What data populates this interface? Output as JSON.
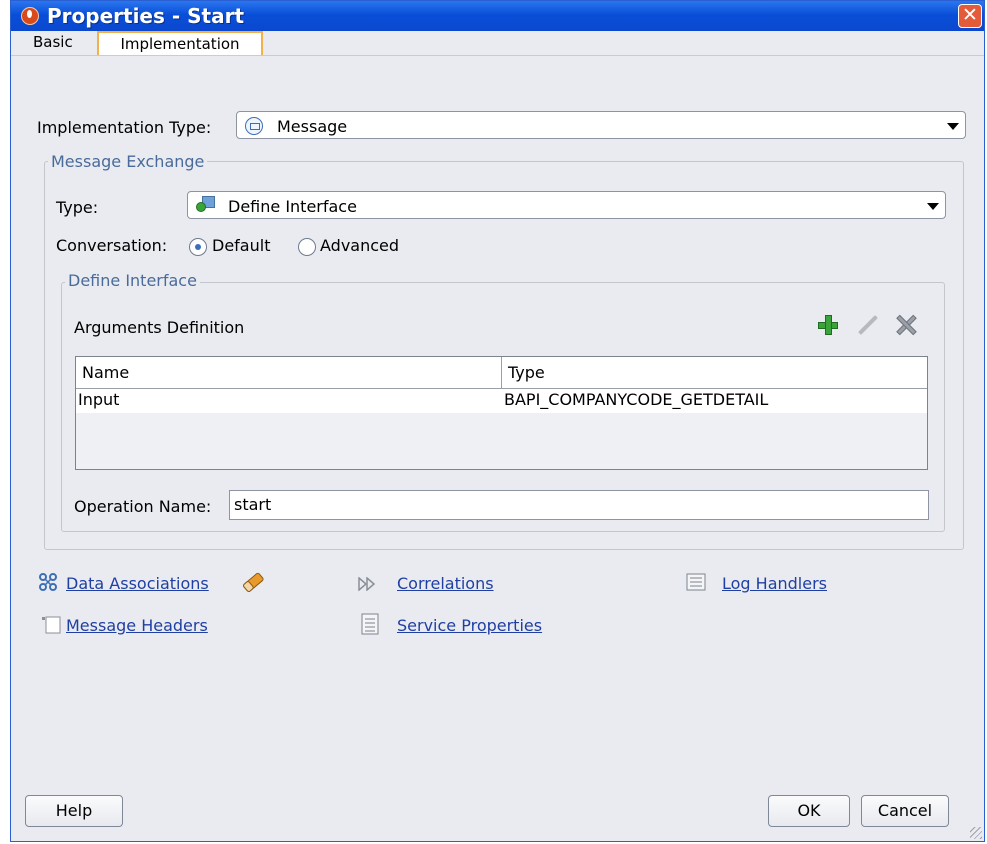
{
  "window": {
    "title": "Properties - Start"
  },
  "tabs": [
    {
      "label": "Basic"
    },
    {
      "label": "Implementation"
    }
  ],
  "implementation_type": {
    "label": "Implementation Type:",
    "value": "Message",
    "icon": "message-icon"
  },
  "message_exchange": {
    "title": "Message Exchange",
    "type_label": "Type:",
    "type_value": "Define Interface",
    "conversation_label": "Conversation:",
    "conversation_options": [
      {
        "label": "Default",
        "selected": true
      },
      {
        "label": "Advanced",
        "selected": false
      }
    ]
  },
  "define_interface": {
    "title": "Define Interface",
    "arguments_label": "Arguments Definition",
    "toolbar": {
      "add_icon": "plus-icon",
      "edit_icon": "pencil-icon",
      "delete_icon": "x-icon"
    },
    "columns": [
      "Name",
      "Type"
    ],
    "rows": [
      {
        "name": "Input",
        "type": "BAPI_COMPANYCODE_GETDETAIL"
      }
    ],
    "operation_label": "Operation Name:",
    "operation_value": "start"
  },
  "links": {
    "data_associations": "Data Associations",
    "correlations": "Correlations",
    "log_handlers": "Log Handlers",
    "message_headers": "Message Headers",
    "service_properties": "Service Properties"
  },
  "buttons": {
    "help": "Help",
    "ok": "OK",
    "cancel": "Cancel"
  },
  "colors": {
    "titlebar": "#0a4fd8",
    "tab_active_border": "#f3b249",
    "link": "#1f3fa3"
  }
}
